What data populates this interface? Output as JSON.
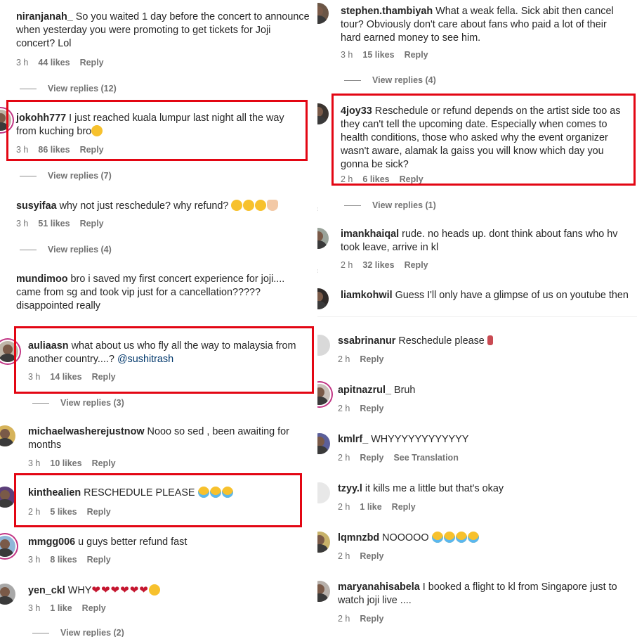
{
  "left_comments": [
    {
      "user": "niranjanah_",
      "text": " So you waited 1 day before the concert to announce when yesterday you were promoting to get tickets for Joji concert? Lol",
      "time": "3 h",
      "likes": "44 likes",
      "reply": "Reply",
      "view_replies": "View replies (12)"
    },
    {
      "user": "jokohh777",
      "text": " I just reached kuala lumpur last night all the way from kuching bro",
      "emoji": "sad",
      "time": "3 h",
      "likes": "86 likes",
      "reply": "Reply",
      "view_replies": "View replies (7)"
    },
    {
      "user": "susyifaa",
      "text": " why not just reschedule? why refund? ",
      "emoji": "sad3pray",
      "time": "3 h",
      "likes": "51 likes",
      "reply": "Reply",
      "view_replies": "View replies (4)"
    },
    {
      "user": "mundimoo",
      "text": " bro i saved my first concert experience for joji.... came from sg and took vip just for a cancellation????? disappointed really"
    },
    {
      "user": "auliaasn",
      "text": " what about us who fly all the way to malaysia from another country....? ",
      "mention": "@sushitrash",
      "time": "3 h",
      "likes": "14 likes",
      "reply": "Reply",
      "view_replies": "View replies (3)"
    },
    {
      "user": "michaelwasherejustnow",
      "text": " Nooo so sed , been awaiting for months",
      "time": "3 h",
      "likes": "10 likes",
      "reply": "Reply"
    },
    {
      "user": "kinthealien",
      "text": " RESCHEDULE PLEASE ",
      "emoji": "cry3",
      "time": "2 h",
      "likes": "5 likes",
      "reply": "Reply"
    },
    {
      "user": "mmgg006",
      "text": " u guys better refund fast",
      "time": "3 h",
      "likes": "8 likes",
      "reply": "Reply"
    },
    {
      "user": "yen_ckl",
      "text": " WHY",
      "emoji": "hearts",
      "time": "3 h",
      "likes": "1 like",
      "reply": "Reply",
      "view_replies": "View replies (2)"
    }
  ],
  "right_comments": [
    {
      "user": "stephen.thambiyah",
      "text": " What a weak fella. Sick abit then cancel tour? Obviously don't care about fans who paid a lot of their hard earned money to see him.",
      "time": "3 h",
      "likes": "15 likes",
      "reply": "Reply",
      "view_replies": "View replies (4)"
    },
    {
      "user": "4joy33",
      "text": " Reschedule or refund depends on the artist side too as they can't tell the upcoming date. Especially when comes to health conditions, those who asked why the event organizer wasn't aware, alamak la gaiss you will know which day you gonna be sick?",
      "time": "2 h",
      "likes": "6 likes",
      "reply": "Reply",
      "view_replies": "View replies (1)"
    },
    {
      "user": "imankhaiqal",
      "text": " rude. no heads up. dont think about fans who hv took leave, arrive in kl",
      "time": "2 h",
      "likes": "32 likes",
      "reply": "Reply"
    },
    {
      "user": "liamkohwil",
      "text": " Guess I'll only have a glimpse of us on youtube then"
    },
    {
      "user": "ssabrinanur",
      "text": " Reschedule please ",
      "time": "2 h",
      "reply": "Reply"
    },
    {
      "user": "apitnazrul_",
      "text": " Bruh",
      "time": "2 h",
      "reply": "Reply"
    },
    {
      "user": "kmlrf_",
      "text": " WHYYYYYYYYYYYY",
      "time": "2 h",
      "reply": "Reply",
      "translation": "See Translation"
    },
    {
      "user": "tzyy.l",
      "text": " it kills me a little but that's okay",
      "time": "2 h",
      "likes": "1 like",
      "reply": "Reply"
    },
    {
      "user": "lqmnzbd",
      "text": " NOOOOO ",
      "emoji": "cry4",
      "time": "2 h",
      "reply": "Reply"
    },
    {
      "user": "maryanahisabela",
      "text": " I booked a flight to kl from Singapore just to watch joji live ....",
      "time": "2 h",
      "reply": "Reply"
    }
  ],
  "colors": {
    "highlight": "#e30613",
    "meta": "#737373",
    "mention": "#00376b",
    "story_ring": "#c13584"
  }
}
